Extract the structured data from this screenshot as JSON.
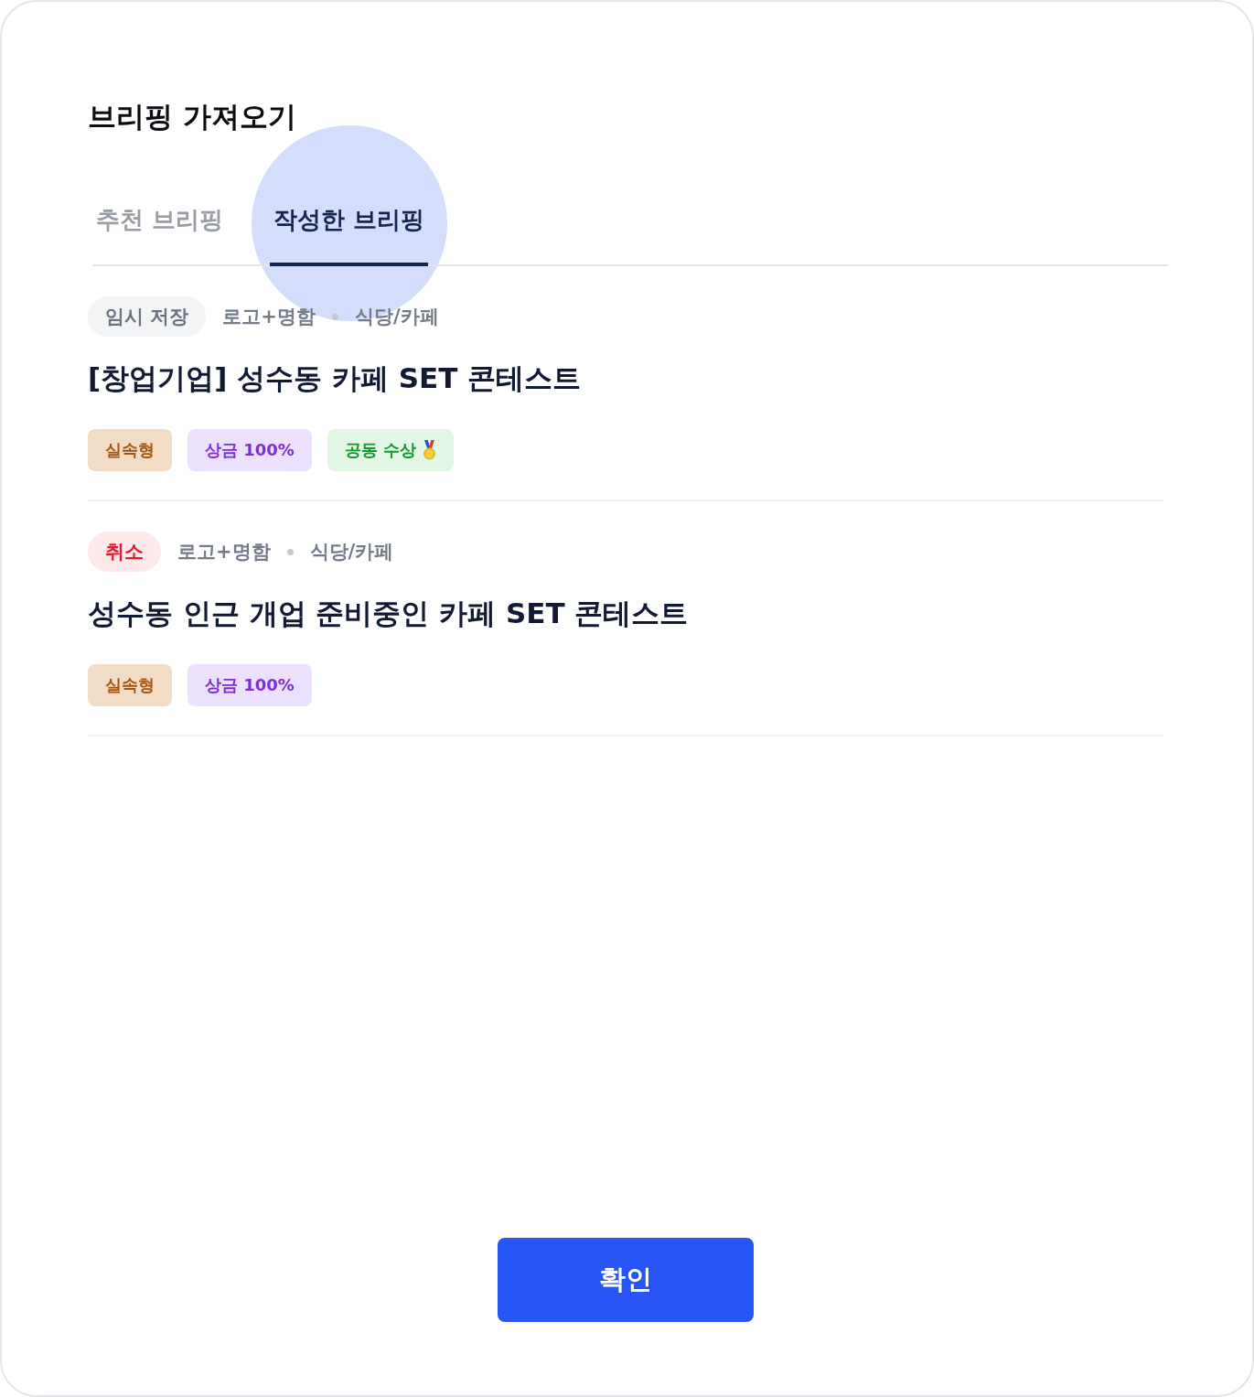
{
  "dialog": {
    "title": "브리핑 가져오기"
  },
  "tabs": [
    {
      "label": "추천 브리핑",
      "selected": false,
      "pressed": false
    },
    {
      "label": "작성한 브리핑",
      "selected": true,
      "pressed": true
    }
  ],
  "briefings": [
    {
      "status": {
        "kind": "draft",
        "label": "임시 저장"
      },
      "category": "로고+명함",
      "subcategory": "식당/카페",
      "title": "[창업기업] 성수동 카페 SET 콘테스트",
      "tags": [
        {
          "kind": "type",
          "label": "실속형"
        },
        {
          "kind": "prize",
          "label": "상금 100%"
        },
        {
          "kind": "award",
          "label": "공동 수상"
        }
      ]
    },
    {
      "status": {
        "kind": "canceled",
        "label": "취소"
      },
      "category": "로고+명함",
      "subcategory": "식당/카페",
      "title": "성수동 인근 개업 준비중인 카페 SET 콘테스트",
      "tags": [
        {
          "kind": "type",
          "label": "실속형"
        },
        {
          "kind": "prize",
          "label": "상금 100%"
        }
      ]
    }
  ],
  "confirm_button": {
    "label": "확인"
  }
}
